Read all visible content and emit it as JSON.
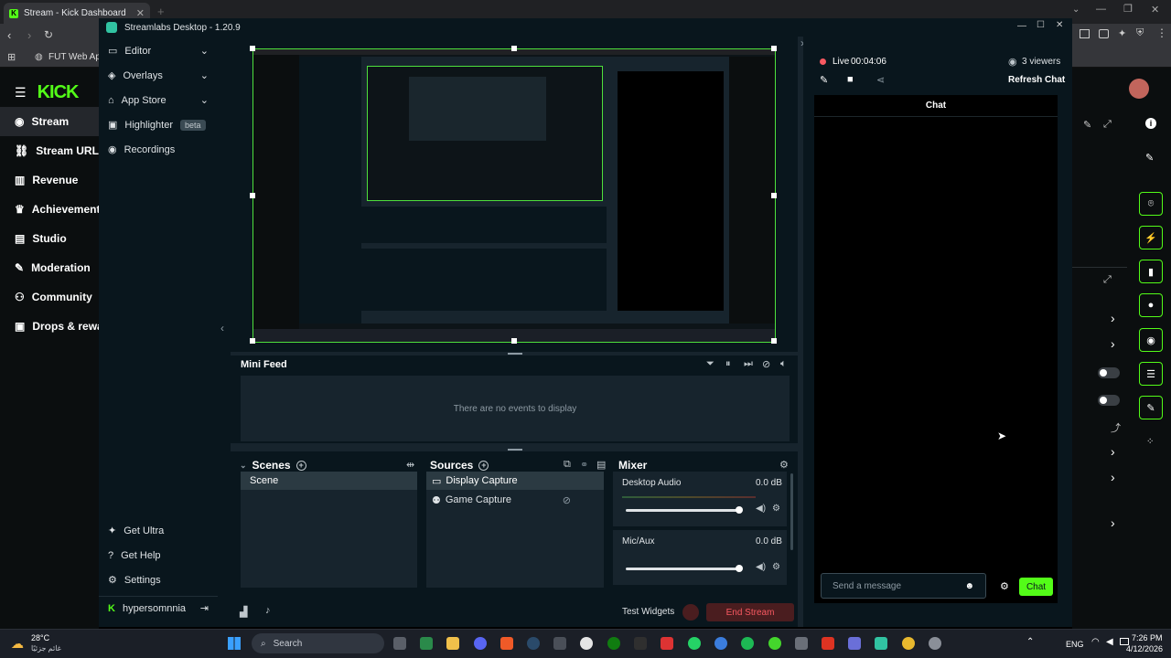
{
  "browser": {
    "tab_title": "Stream - Kick Dashboard",
    "new_tab": "+",
    "bookmark": "FUT Web App -"
  },
  "kick": {
    "logo": "KICK",
    "nav": [
      "Stream",
      "Stream URL &",
      "Revenue",
      "Achievements",
      "Studio",
      "Moderation",
      "Community",
      "Drops & rewa"
    ]
  },
  "streamlabs": {
    "title": "Streamlabs Desktop - 1.20.9",
    "nav": {
      "editor": "Editor",
      "overlays": "Overlays",
      "app_store": "App Store",
      "highlighter": "Highlighter",
      "beta": "beta",
      "recordings": "Recordings",
      "get_ultra": "Get Ultra",
      "get_help": "Get Help",
      "settings": "Settings",
      "user": "hypersomnnia"
    },
    "mini_feed": {
      "title": "Mini Feed",
      "empty": "There are no events to display"
    },
    "scenes": {
      "title": "Scenes",
      "items": [
        "Scene"
      ]
    },
    "sources": {
      "title": "Sources",
      "items": [
        "Display Capture",
        "Game Capture"
      ]
    },
    "mixer": {
      "title": "Mixer",
      "channels": [
        {
          "name": "Desktop Audio",
          "level": "0.0 dB"
        },
        {
          "name": "Mic/Aux",
          "level": "0.0 dB"
        }
      ]
    },
    "footer": {
      "test_widgets": "Test Widgets",
      "end_stream": "End Stream"
    }
  },
  "chat_panel": {
    "live": "Live",
    "time": "00:04:06",
    "viewers": "3 viewers",
    "refresh": "Refresh Chat",
    "chat_title": "Chat",
    "placeholder": "Send a message",
    "chat_button": "Chat"
  },
  "taskbar": {
    "temperature": "28°C",
    "weather_desc": "غائم جزئيًا",
    "search": "Search",
    "lang": "ENG",
    "time": "7:26 PM",
    "date": "4/12/2026"
  },
  "colors": {
    "accent": "#53fc18",
    "danger": "#f85961",
    "panel": "#09161d",
    "body": "#17242d"
  }
}
